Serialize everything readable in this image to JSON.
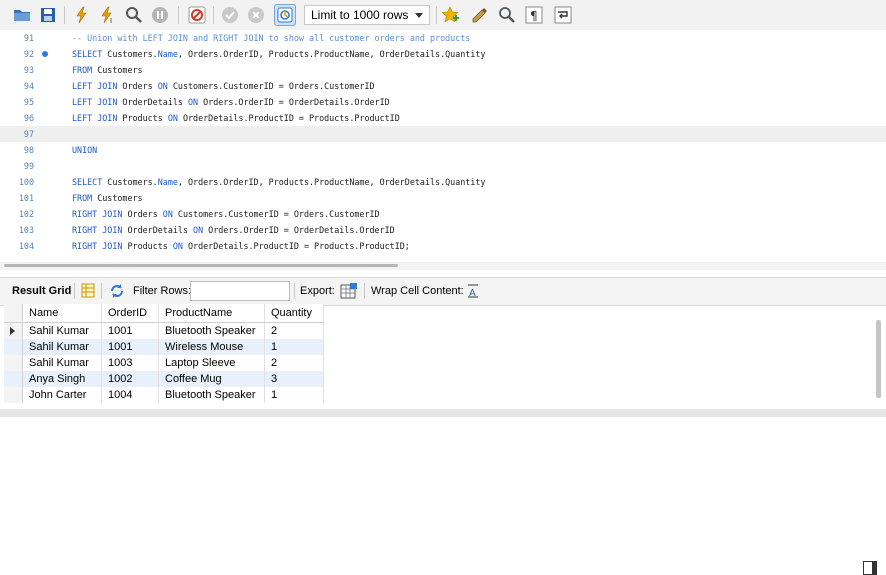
{
  "toolbar": {
    "limit_label": "Limit to 1000 rows",
    "buttons": [
      {
        "name": "open-folder-icon",
        "color": "#3b6fb6"
      },
      {
        "name": "save-icon",
        "color": "#2a5fa8"
      },
      {
        "name": "execute-lightning-icon",
        "color": "#e6a100"
      },
      {
        "name": "execute-statement-lightning-icon",
        "color": "#e6a100"
      },
      {
        "name": "explain-magnifier-icon",
        "color": "#555555"
      },
      {
        "name": "stop-icon",
        "color": "#9a9a9a"
      },
      {
        "name": "toggle-continue-on-error-icon",
        "color": "#d23b2b"
      },
      {
        "name": "commit-check-icon",
        "color": "#a8a8a8"
      },
      {
        "name": "rollback-cancel-icon",
        "color": "#a8a8a8"
      },
      {
        "name": "autocommit-icon",
        "color": "#2e7bd6"
      },
      {
        "name": "bookmark-star-icon",
        "color": "#e6a100"
      },
      {
        "name": "beautify-brush-icon",
        "color": "#7a5a2a"
      },
      {
        "name": "find-magnifier-icon",
        "color": "#555555"
      },
      {
        "name": "invisible-chars-pilcrow-icon",
        "color": "#333333"
      },
      {
        "name": "wrap-lines-icon",
        "color": "#333333"
      }
    ]
  },
  "editor": {
    "lines": [
      {
        "num": "91",
        "kind": "comment",
        "text": "-- Union with LEFT JOIN and RIGHT JOIN to show all customer orders and products"
      },
      {
        "num": "92",
        "kind": "code",
        "breakpoint": true,
        "text": "SELECT Customers.Name, Orders.OrderID, Products.ProductName, OrderDetails.Quantity"
      },
      {
        "num": "93",
        "kind": "code",
        "text": "FROM Customers"
      },
      {
        "num": "94",
        "kind": "code",
        "text": "LEFT JOIN Orders ON Customers.CustomerID = Orders.CustomerID"
      },
      {
        "num": "95",
        "kind": "code",
        "text": "LEFT JOIN OrderDetails ON Orders.OrderID = OrderDetails.OrderID"
      },
      {
        "num": "96",
        "kind": "code",
        "text": "LEFT JOIN Products ON OrderDetails.ProductID = Products.ProductID"
      },
      {
        "num": "97",
        "kind": "code",
        "current": true,
        "text": ""
      },
      {
        "num": "98",
        "kind": "code",
        "text": "UNION"
      },
      {
        "num": "99",
        "kind": "code",
        "text": ""
      },
      {
        "num": "100",
        "kind": "code",
        "text": "SELECT Customers.Name, Orders.OrderID, Products.ProductName, OrderDetails.Quantity"
      },
      {
        "num": "101",
        "kind": "code",
        "text": "FROM Customers"
      },
      {
        "num": "102",
        "kind": "code",
        "text": "RIGHT JOIN Orders ON Customers.CustomerID = Orders.CustomerID"
      },
      {
        "num": "103",
        "kind": "code",
        "text": "RIGHT JOIN OrderDetails ON Orders.OrderID = OrderDetails.OrderID"
      },
      {
        "num": "104",
        "kind": "code",
        "text": "RIGHT JOIN Products ON OrderDetails.ProductID = Products.ProductID;"
      }
    ],
    "keywords": [
      "SELECT",
      "FROM",
      "LEFT",
      "RIGHT",
      "JOIN",
      "ON",
      "UNION",
      "Name"
    ]
  },
  "results_toolbar": {
    "result_grid_label": "Result Grid",
    "filter_label": "Filter Rows:",
    "filter_value": "",
    "export_label": "Export:",
    "wrap_label": "Wrap Cell Content:"
  },
  "grid": {
    "columns": [
      "Name",
      "OrderID",
      "ProductName",
      "Quantity"
    ],
    "rows": [
      [
        "Sahil Kumar",
        "1001",
        "Bluetooth Speaker",
        "2"
      ],
      [
        "Sahil Kumar",
        "1001",
        "Wireless Mouse",
        "1"
      ],
      [
        "Sahil Kumar",
        "1003",
        "Laptop Sleeve",
        "2"
      ],
      [
        "Anya Singh",
        "1002",
        "Coffee Mug",
        "3"
      ],
      [
        "John Carter",
        "1004",
        "Bluetooth Speaker",
        "1"
      ]
    ]
  },
  "colors": {
    "keyword": "#2458c8",
    "comment": "#5b8ed6",
    "line_number": "#5a7fb0",
    "alt_row": "#e8f0fb"
  }
}
